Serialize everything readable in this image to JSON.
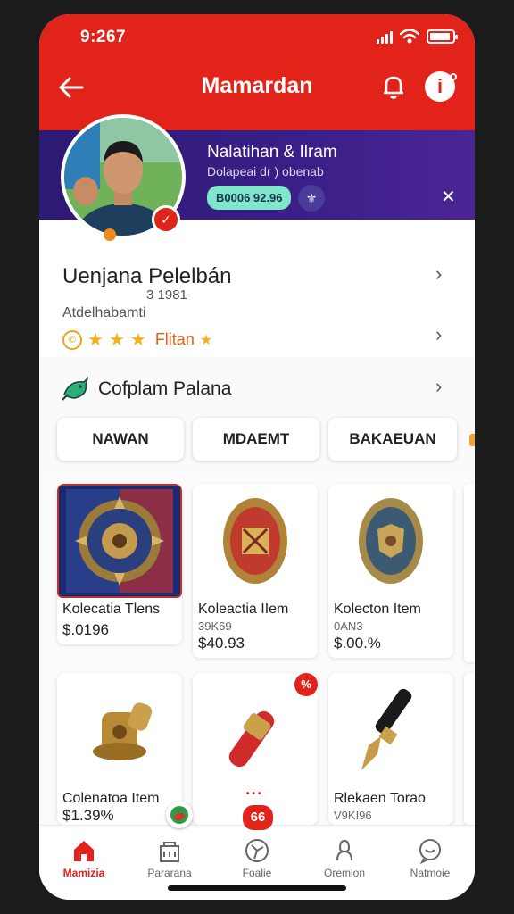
{
  "status": {
    "time": "9:267"
  },
  "header": {
    "title": "Mamardan"
  },
  "promo": {
    "title": "Nalatihan & Ilram",
    "subtitle": "Dolapeai dr ) obenab",
    "code": "B0006 92.96"
  },
  "profile": {
    "name": "Uenjana Pelelbán",
    "meta": "3 1981",
    "handle": "Atdelhabamti",
    "rating_label": "Flitan"
  },
  "section": {
    "title": "Cofplam Palana",
    "tabs": [
      "NAWAN",
      "MDAEMT",
      "BAKAEUAN"
    ]
  },
  "items": [
    {
      "name": "Kolecatia Tlens",
      "sub": "",
      "price": "$.0196"
    },
    {
      "name": "Koleactia IIem",
      "sub": "39K69",
      "price": "$40.93"
    },
    {
      "name": "Kolecton Item",
      "sub": "0AN3",
      "price": "$.00.%"
    },
    {
      "name": "Colenatoa Item",
      "sub": "",
      "price": "$1.39%"
    },
    {
      "name": "",
      "sub": "",
      "price": ""
    },
    {
      "name": "Rlekaen Torao",
      "sub": "V9KI96",
      "price": ""
    }
  ],
  "fab": {
    "label": "66"
  },
  "nav": [
    {
      "label": "Mamizia",
      "icon": "home-icon"
    },
    {
      "label": "Pararana",
      "icon": "store-icon"
    },
    {
      "label": "Foalie",
      "icon": "explore-icon"
    },
    {
      "label": "Oremlon",
      "icon": "user-icon"
    },
    {
      "label": "Natmoie",
      "icon": "chat-icon"
    }
  ],
  "colors": {
    "primary": "#e2231a",
    "promo": "#3a1f88",
    "accent": "#7ee6c9",
    "star": "#f4b11d"
  }
}
